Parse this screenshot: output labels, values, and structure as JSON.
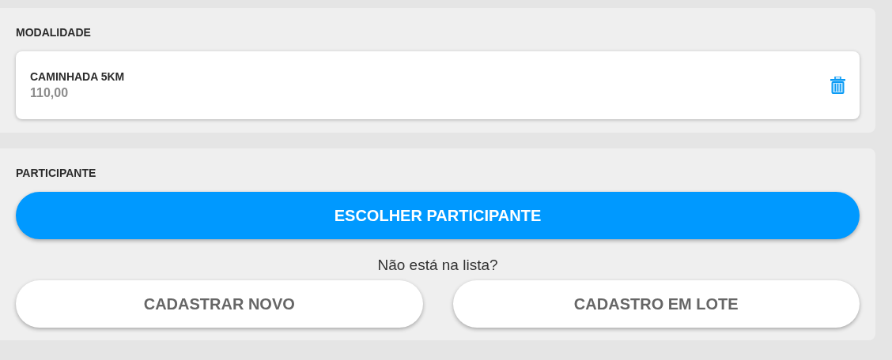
{
  "modality": {
    "heading": "MODALIDADE",
    "items": [
      {
        "name": "CAMINHADA 5KM",
        "price": "110,00"
      }
    ]
  },
  "participant": {
    "heading": "PARTICIPANTE",
    "choose_button": "ESCOLHER PARTICIPANTE",
    "prompt": "Não está na lista?",
    "buttons": [
      "CADASTRAR NOVO",
      "CADASTRO EM LOTE"
    ]
  }
}
